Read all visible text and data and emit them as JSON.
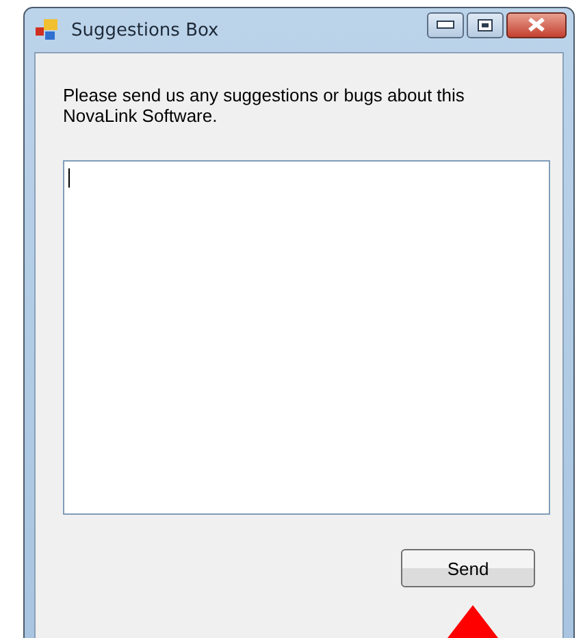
{
  "window": {
    "title": "Suggestions Box"
  },
  "message": "Please send us any suggestions or bugs about this NovaLink Software.",
  "suggestion_field": {
    "focused": true
  },
  "buttons": [
    {
      "label": "Send"
    }
  ]
}
